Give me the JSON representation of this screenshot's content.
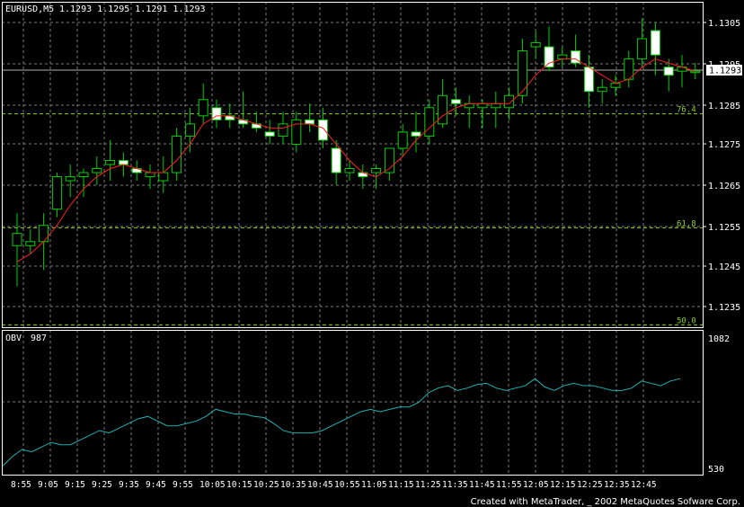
{
  "chart_data": [
    {
      "type": "candlestick",
      "title": "EURUSD,M5",
      "ohlc_readout": "1.1293 1.1295 1.1291 1.1293",
      "current_price_label": "1.1293",
      "y_ticks": [
        "1.1305",
        "1.1295",
        "1.1285",
        "1.1275",
        "1.1265",
        "1.1255",
        "1.1245",
        "1.1235"
      ],
      "ylim": [
        1.1227,
        1.131
      ],
      "fib_levels": [
        {
          "label": "76.4",
          "value": 1.12825
        },
        {
          "label": "61.8",
          "value": 1.12544
        },
        {
          "label": "50.0",
          "value": 1.12305
        }
      ],
      "candles": [
        {
          "o": 1.125,
          "h": 1.1258,
          "l": 1.124,
          "c": 1.1253
        },
        {
          "o": 1.125,
          "h": 1.1254,
          "l": 1.1248,
          "c": 1.1251
        },
        {
          "o": 1.1251,
          "h": 1.1258,
          "l": 1.1244,
          "c": 1.1255
        },
        {
          "o": 1.1259,
          "h": 1.1268,
          "l": 1.1257,
          "c": 1.1267
        },
        {
          "o": 1.1266,
          "h": 1.127,
          "l": 1.1262,
          "c": 1.1267
        },
        {
          "o": 1.1267,
          "h": 1.1269,
          "l": 1.1262,
          "c": 1.1268
        },
        {
          "o": 1.1268,
          "h": 1.1272,
          "l": 1.1265,
          "c": 1.1269
        },
        {
          "o": 1.127,
          "h": 1.1276,
          "l": 1.1266,
          "c": 1.1271
        },
        {
          "o": 1.1271,
          "h": 1.1273,
          "l": 1.1267,
          "c": 1.127
        },
        {
          "o": 1.1269,
          "h": 1.1271,
          "l": 1.1266,
          "c": 1.1268
        },
        {
          "o": 1.1267,
          "h": 1.127,
          "l": 1.1264,
          "c": 1.1268
        },
        {
          "o": 1.1266,
          "h": 1.1272,
          "l": 1.1263,
          "c": 1.1268
        },
        {
          "o": 1.1268,
          "h": 1.1279,
          "l": 1.1266,
          "c": 1.1277
        },
        {
          "o": 1.1277,
          "h": 1.1284,
          "l": 1.1273,
          "c": 1.128
        },
        {
          "o": 1.1282,
          "h": 1.129,
          "l": 1.128,
          "c": 1.1286
        },
        {
          "o": 1.1284,
          "h": 1.1286,
          "l": 1.1279,
          "c": 1.1281
        },
        {
          "o": 1.1282,
          "h": 1.1285,
          "l": 1.1279,
          "c": 1.1281
        },
        {
          "o": 1.1281,
          "h": 1.1288,
          "l": 1.1279,
          "c": 1.128
        },
        {
          "o": 1.128,
          "h": 1.1283,
          "l": 1.1278,
          "c": 1.1279
        },
        {
          "o": 1.1278,
          "h": 1.1281,
          "l": 1.1275,
          "c": 1.1277
        },
        {
          "o": 1.1277,
          "h": 1.1283,
          "l": 1.1275,
          "c": 1.128
        },
        {
          "o": 1.1275,
          "h": 1.1283,
          "l": 1.1273,
          "c": 1.1281
        },
        {
          "o": 1.1281,
          "h": 1.1285,
          "l": 1.1278,
          "c": 1.128
        },
        {
          "o": 1.1281,
          "h": 1.1284,
          "l": 1.1274,
          "c": 1.1276
        },
        {
          "o": 1.1274,
          "h": 1.1276,
          "l": 1.1265,
          "c": 1.1268
        },
        {
          "o": 1.1268,
          "h": 1.1271,
          "l": 1.1266,
          "c": 1.1269
        },
        {
          "o": 1.1268,
          "h": 1.127,
          "l": 1.1264,
          "c": 1.1267
        },
        {
          "o": 1.1268,
          "h": 1.127,
          "l": 1.1264,
          "c": 1.1269
        },
        {
          "o": 1.1268,
          "h": 1.1272,
          "l": 1.1266,
          "c": 1.1274
        },
        {
          "o": 1.1274,
          "h": 1.128,
          "l": 1.1272,
          "c": 1.1278
        },
        {
          "o": 1.1278,
          "h": 1.1283,
          "l": 1.1273,
          "c": 1.1277
        },
        {
          "o": 1.1277,
          "h": 1.1286,
          "l": 1.1275,
          "c": 1.1284
        },
        {
          "o": 1.128,
          "h": 1.1291,
          "l": 1.1279,
          "c": 1.1287
        },
        {
          "o": 1.1286,
          "h": 1.1289,
          "l": 1.1282,
          "c": 1.1285
        },
        {
          "o": 1.1284,
          "h": 1.1287,
          "l": 1.1279,
          "c": 1.1285
        },
        {
          "o": 1.1284,
          "h": 1.1286,
          "l": 1.1279,
          "c": 1.1285
        },
        {
          "o": 1.1284,
          "h": 1.1288,
          "l": 1.1279,
          "c": 1.1285
        },
        {
          "o": 1.1284,
          "h": 1.1289,
          "l": 1.1281,
          "c": 1.1287
        },
        {
          "o": 1.1287,
          "h": 1.1301,
          "l": 1.1285,
          "c": 1.1298
        },
        {
          "o": 1.1299,
          "h": 1.1303,
          "l": 1.1296,
          "c": 1.13
        },
        {
          "o": 1.1299,
          "h": 1.1304,
          "l": 1.1293,
          "c": 1.1294
        },
        {
          "o": 1.1296,
          "h": 1.1299,
          "l": 1.1294,
          "c": 1.1297
        },
        {
          "o": 1.1298,
          "h": 1.1302,
          "l": 1.1294,
          "c": 1.1295
        },
        {
          "o": 1.1294,
          "h": 1.1297,
          "l": 1.1284,
          "c": 1.1288
        },
        {
          "o": 1.1288,
          "h": 1.1291,
          "l": 1.1285,
          "c": 1.1289
        },
        {
          "o": 1.1289,
          "h": 1.1292,
          "l": 1.1287,
          "c": 1.129
        },
        {
          "o": 1.1291,
          "h": 1.1298,
          "l": 1.1289,
          "c": 1.1296
        },
        {
          "o": 1.1296,
          "h": 1.1306,
          "l": 1.1294,
          "c": 1.1301
        },
        {
          "o": 1.1303,
          "h": 1.1305,
          "l": 1.1292,
          "c": 1.1297
        },
        {
          "o": 1.1294,
          "h": 1.1296,
          "l": 1.1288,
          "c": 1.1292
        },
        {
          "o": 1.1293,
          "h": 1.1297,
          "l": 1.1289,
          "c": 1.1294
        },
        {
          "o": 1.1293,
          "h": 1.1295,
          "l": 1.1291,
          "c": 1.1293
        }
      ],
      "ma": [
        1.1246,
        1.1248,
        1.1251,
        1.1255,
        1.126,
        1.1264,
        1.1267,
        1.1269,
        1.127,
        1.1269,
        1.1268,
        1.1268,
        1.1271,
        1.1275,
        1.128,
        1.1282,
        1.1282,
        1.1281,
        1.128,
        1.1279,
        1.1279,
        1.128,
        1.128,
        1.1279,
        1.1275,
        1.1271,
        1.1268,
        1.1267,
        1.1269,
        1.1272,
        1.1276,
        1.1279,
        1.1282,
        1.1284,
        1.1285,
        1.1285,
        1.1285,
        1.1285,
        1.1288,
        1.1292,
        1.1295,
        1.1296,
        1.1296,
        1.1294,
        1.1292,
        1.129,
        1.1291,
        1.1294,
        1.1296,
        1.1295,
        1.1294,
        1.1293
      ]
    },
    {
      "type": "line",
      "title": "OBV",
      "readout": "987",
      "y_ticks": [
        "1082",
        "530"
      ],
      "ylim": [
        530,
        1082
      ],
      "x_ticks": [
        "8:55",
        "9:05",
        "9:15",
        "9:25",
        "9:35",
        "9:45",
        "9:55",
        "10:05",
        "10:15",
        "10:25",
        "10:35",
        "10:45",
        "10:55",
        "11:05",
        "11:15",
        "11:25",
        "11:35",
        "11:45",
        "11:55",
        "12:05",
        "12:15",
        "12:25",
        "12:35",
        "12:45"
      ],
      "series": [
        {
          "values": [
            540,
            580,
            610,
            600,
            620,
            640,
            630,
            630,
            650,
            670,
            690,
            680,
            700,
            720,
            740,
            750,
            730,
            710,
            710,
            720,
            730,
            750,
            780,
            770,
            760,
            760,
            750,
            745,
            720,
            690,
            680,
            680,
            680,
            690,
            710,
            730,
            750,
            770,
            780,
            770,
            780,
            790,
            790,
            810,
            850,
            870,
            880,
            860,
            870,
            885,
            890,
            870,
            860,
            870,
            880,
            910,
            875,
            860,
            880,
            890,
            880,
            880,
            870,
            860,
            860,
            870,
            900,
            890,
            880,
            900,
            910
          ]
        }
      ]
    }
  ],
  "credit": "Created with MetaTrader, _ 2002 MetaQuotes Sofware Corp.",
  "colors": {
    "background": "#000000",
    "frame": "#ffffff",
    "grid": "#7a7a7a",
    "bull": "#00d000",
    "bear_fill": "#ffffff",
    "ma": "#ff2020",
    "fib": "#8cd21e",
    "obv": "#20b0b0",
    "text": "#ffffff"
  }
}
